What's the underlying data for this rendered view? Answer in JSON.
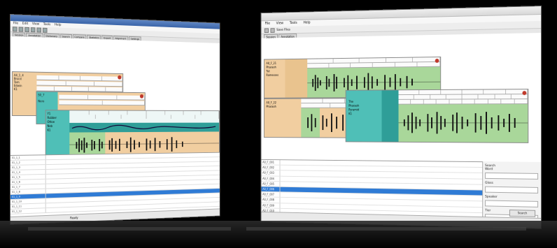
{
  "left_window": {
    "title": "",
    "menu": [
      "File",
      "Edit",
      "View",
      "Tools",
      "Help"
    ],
    "tabs": [
      "Session",
      "Annotation",
      "Dictionary",
      "Search",
      "Compare",
      "Statistics",
      "Export",
      "Alignment",
      "Settings"
    ],
    "panes": [
      {
        "name": "pane-1",
        "labels": [
          "A4_1_4",
          "Bruce",
          "Tom",
          "Edwin",
          "K1"
        ]
      },
      {
        "name": "pane-2",
        "labels": [
          "S0_7",
          "Nero"
        ]
      },
      {
        "name": "pane-3",
        "labels": [
          "Y1",
          "Rubber",
          "Ottoe",
          "Neb",
          "K1"
        ]
      }
    ],
    "list_rows": [
      {
        "c1": "S1_1_1",
        "c2": "",
        "selected": false
      },
      {
        "c1": "S1_1_2",
        "c2": "",
        "selected": false
      },
      {
        "c1": "S1_1_3",
        "c2": "",
        "selected": false
      },
      {
        "c1": "S1_1_4",
        "c2": "",
        "selected": false
      },
      {
        "c1": "S1_1_5",
        "c2": "",
        "selected": false
      },
      {
        "c1": "S1_1_6",
        "c2": "",
        "selected": false
      },
      {
        "c1": "S1_1_7",
        "c2": "",
        "selected": false
      },
      {
        "c1": "S1_1_8",
        "c2": "",
        "selected": false
      },
      {
        "c1": "S1_1_9",
        "c2": "",
        "selected": true
      },
      {
        "c1": "S1_1_10",
        "c2": "",
        "selected": false
      },
      {
        "c1": "S1_1_11",
        "c2": "",
        "selected": false
      },
      {
        "c1": "S1_1_12",
        "c2": "",
        "selected": false
      }
    ],
    "status": "Ready"
  },
  "right_window": {
    "title": "",
    "menu": [
      "File",
      "View",
      "Tools",
      "Help"
    ],
    "toolbar_label": "Save Files",
    "tabs": [
      "Session",
      "Annotation"
    ],
    "panes": [
      {
        "name": "pane-a",
        "labels": [
          "A0_F_21",
          "Pharaoh",
          "Tut",
          "Ramesses"
        ]
      },
      {
        "name": "pane-b",
        "labels": [
          "A0_F_22",
          "Pharaoh"
        ]
      },
      {
        "name": "pane-c",
        "labels": [
          "The",
          "Pharaoh",
          "Pyramid",
          "K1"
        ]
      }
    ],
    "list_rows": [
      {
        "c1": "A0_F_001",
        "c2": "",
        "selected": false
      },
      {
        "c1": "A0_F_002",
        "c2": "",
        "selected": false
      },
      {
        "c1": "A0_F_003",
        "c2": "",
        "selected": false
      },
      {
        "c1": "A0_F_004",
        "c2": "",
        "selected": false
      },
      {
        "c1": "A0_F_005",
        "c2": "",
        "selected": false
      },
      {
        "c1": "A0_F_006",
        "c2": "",
        "selected": true
      },
      {
        "c1": "A0_F_007",
        "c2": "",
        "selected": false
      },
      {
        "c1": "A0_F_008",
        "c2": "",
        "selected": false
      },
      {
        "c1": "A0_F_009",
        "c2": "",
        "selected": false
      },
      {
        "c1": "A0_F_010",
        "c2": "",
        "selected": false
      },
      {
        "c1": "A0_F_011",
        "c2": "",
        "selected": false
      },
      {
        "c1": "A0_F_012",
        "c2": "",
        "selected": false
      }
    ],
    "side_fields": [
      "Search",
      "Word",
      "Gloss",
      "Speaker",
      "Tier"
    ],
    "search_button": "Search",
    "status": ""
  },
  "colors": {
    "pane_orange": "#f1cea0",
    "pane_green": "#a9d79a",
    "pane_teal": "#4fbfb7",
    "pane_teal_dark": "#2f9e98",
    "selection_blue": "#2f7bd5",
    "window_bg": "#f3f3f3"
  },
  "icons": [
    "close-icon",
    "play-icon",
    "stop-icon",
    "record-icon",
    "zoom-icon"
  ]
}
